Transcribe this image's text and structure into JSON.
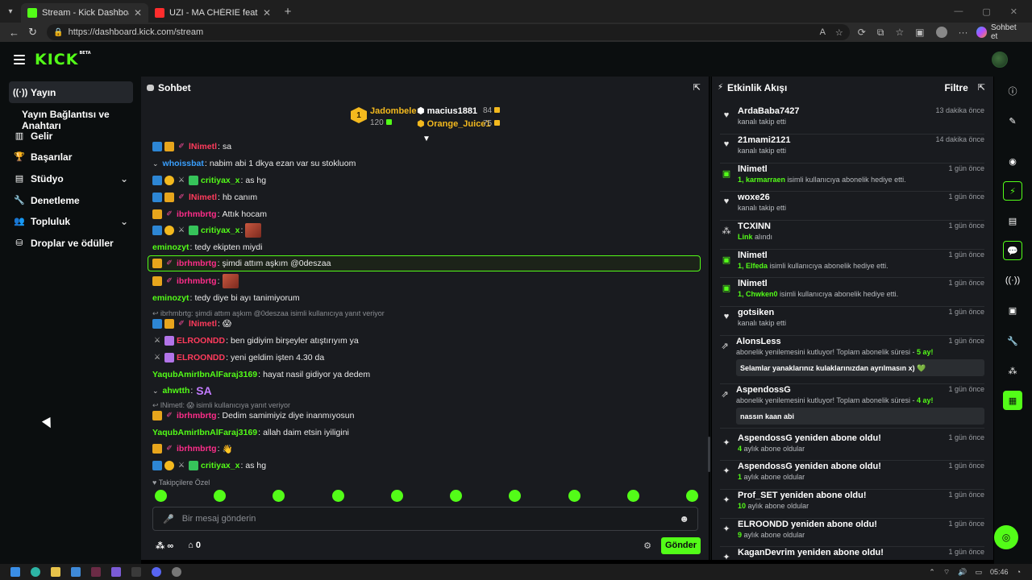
{
  "browser": {
    "tabs": [
      {
        "title": "Stream - Kick Dashboard",
        "active": true,
        "favicon": "kick-favicon"
      },
      {
        "title": "UZI - MA CHÉRIE feat. AKSAN",
        "active": false,
        "favicon": "youtube-favicon"
      }
    ],
    "url": "https://dashboard.kick.com/stream",
    "copilot_label": "Sohbet et"
  },
  "app": {
    "logo": "KICK",
    "logo_badge": "BETA"
  },
  "nav": {
    "items": [
      {
        "label": "Yayın",
        "icon": "broadcast-icon"
      },
      {
        "label": "Yayın Bağlantısı ve Anahtarı"
      },
      {
        "label": "Gelir",
        "icon": "revenue-icon"
      },
      {
        "label": "Başarılar",
        "icon": "trophy-icon"
      },
      {
        "label": "Stüdyo",
        "icon": "studio-icon"
      },
      {
        "label": "Denetleme",
        "icon": "wrench-icon"
      },
      {
        "label": "Topluluk",
        "icon": "community-icon"
      },
      {
        "label": "Droplar ve ödüller",
        "icon": "drops-icon"
      }
    ]
  },
  "chat": {
    "title": "Sohbet",
    "leaderboard": {
      "first": {
        "rank": "1",
        "name": "Jadombele",
        "count": "120"
      },
      "second": {
        "name": "macius1881",
        "count": "84"
      },
      "third": {
        "name": "Orange_Juice1",
        "count": "75"
      }
    },
    "messages": [
      {
        "user": "lNimetl",
        "text": "sa",
        "color": "#ff3b5c"
      },
      {
        "user": "whoissbat",
        "text": "nabim abi 1 dkya ezan var su stokluom",
        "color": "#3aa0ff"
      },
      {
        "user": "critiyax_x",
        "text": "as hg",
        "color": "#53fc18"
      },
      {
        "user": "lNimetl",
        "text": "hb canım",
        "color": "#ff3b5c"
      },
      {
        "user": "ibrhmbrtg",
        "text": "Attık hocam",
        "color": "#ff2d8a"
      },
      {
        "user": "critiyax_x",
        "text": "",
        "color": "#53fc18"
      },
      {
        "user": "eminozyt",
        "text": "tedy ekipten miydi",
        "color": "#53fc18"
      },
      {
        "user": "ibrhmbrtg",
        "text": "şimdi attım aşkım @0deszaa",
        "color": "#ff2d8a"
      },
      {
        "user": "ibrhmbrtg",
        "text": "",
        "color": "#ff2d8a"
      },
      {
        "user": "eminozyt",
        "text": "tedy diye bi ayı tanimiyorum",
        "color": "#53fc18"
      },
      {
        "user": "lNimetl",
        "text": "😱",
        "color": "#ff3b5c"
      },
      {
        "user": "ELROONDD",
        "text": "ben gidiyim birşeyler atıştırıyım ya",
        "color": "#ff3b5c"
      },
      {
        "user": "ELROONDD",
        "text": "yeni geldim işten 4.30 da",
        "color": "#ff3b5c"
      },
      {
        "user": "YaqubAmirIbnAlFaraj3169",
        "text": "hayat nasil gidiyor ya dedem",
        "color": "#53fc18"
      },
      {
        "user": "ahwtth",
        "text": "SA",
        "color": "#53fc18"
      },
      {
        "user": "ibrhmbrtg",
        "text": "Dedim samimiyiz diye inanmıyosun",
        "color": "#ff2d8a"
      },
      {
        "user": "YaqubAmirIbnAlFaraj3169",
        "text": "allah daim etsin iyiligini",
        "color": "#53fc18"
      },
      {
        "user": "ibrhmbrtg",
        "text": "",
        "color": "#ff2d8a"
      },
      {
        "user": "critiyax_x",
        "text": "as hg",
        "color": "#53fc18"
      }
    ],
    "replies": [
      "ibrhmbrtg: şimdi attım aşkım @0deszaa isimli kullanıcıya yanıt veriyor",
      "lNimetl: 😱 isimli kullanıcıya yanıt veriyor"
    ],
    "follow_only": "Takipçilere Özel",
    "input_placeholder": "Bir mesaj gönderin",
    "footer": {
      "infinite": "∞",
      "count": "0"
    },
    "send_label": "Gönder"
  },
  "feed": {
    "title": "Etkinlik Akışı",
    "filter_label": "Filtre",
    "events": [
      {
        "name": "ArdaBaba7427",
        "desc": "kanalı takip etti",
        "time": "13 dakika önce",
        "icon": "heart-icon"
      },
      {
        "name": "21mami2121",
        "desc": "kanalı takip etti",
        "time": "14 dakika önce",
        "icon": "heart-icon"
      },
      {
        "name": "lNimetl",
        "desc_pre": "1, karmarraen",
        "desc": "isimli kullanıcıya abonelik hediye etti.",
        "time": "1 gün önce",
        "icon": "gift-icon"
      },
      {
        "name": "woxe26",
        "desc": "kanalı takip etti",
        "time": "1 gün önce",
        "icon": "heart-icon"
      },
      {
        "name": "TCXINN",
        "desc_pre": "Link",
        "desc": "alındı",
        "time": "1 gün önce",
        "icon": "drop-icon"
      },
      {
        "name": "lNimetl",
        "desc_pre": "1, Elfeda",
        "desc": "isimli kullanıcıya abonelik hediye etti.",
        "time": "1 gün önce",
        "icon": "gift-icon"
      },
      {
        "name": "lNimetl",
        "desc_pre": "1, Chwken0",
        "desc": "isimli kullanıcıya abonelik hediye etti.",
        "time": "1 gün önce",
        "icon": "gift-icon"
      },
      {
        "name": "gotsiken",
        "desc": "kanalı takip etti",
        "time": "1 gün önce",
        "icon": "heart-icon"
      },
      {
        "name": "AlonsLess",
        "desc": "abonelik yenilemesini kutluyor! Toplam abonelik süresi -",
        "desc_post": "5 ay!",
        "time": "1 gün önce",
        "icon": "resub-icon",
        "message": "Selamlar yanaklarınız kulaklarınızdan ayrılmasın x) 💚"
      },
      {
        "name": "AspendossG",
        "desc": "abonelik yenilemesini kutluyor! Toplam abonelik süresi -",
        "desc_post": "4 ay!",
        "time": "1 gün önce",
        "icon": "resub-icon",
        "message": "nassın kaan abi"
      },
      {
        "name": "AspendossG yeniden abone oldu!",
        "desc_pre": "4",
        "desc": "aylık abone oldular",
        "time": "1 gün önce",
        "icon": "sparkle-icon"
      },
      {
        "name": "AspendossG yeniden abone oldu!",
        "desc_pre": "1",
        "desc": "aylık abone oldular",
        "time": "1 gün önce",
        "icon": "sparkle-icon"
      },
      {
        "name": "Prof_SET yeniden abone oldu!",
        "desc_pre": "10",
        "desc": "aylık abone oldular",
        "time": "1 gün önce",
        "icon": "sparkle-icon"
      },
      {
        "name": "ELROONDD yeniden abone oldu!",
        "desc_pre": "9",
        "desc": "aylık abone oldular",
        "time": "1 gün önce",
        "icon": "sparkle-icon"
      },
      {
        "name": "KaganDevrim yeniden abone oldu!",
        "desc_pre": "",
        "desc": "",
        "time": "1 gün önce",
        "icon": "sparkle-icon"
      }
    ]
  },
  "taskbar": {
    "time": "05:46"
  },
  "colors": {
    "accent": "#53fc18",
    "panel": "#191b1f",
    "bg": "#0b0e0f"
  }
}
